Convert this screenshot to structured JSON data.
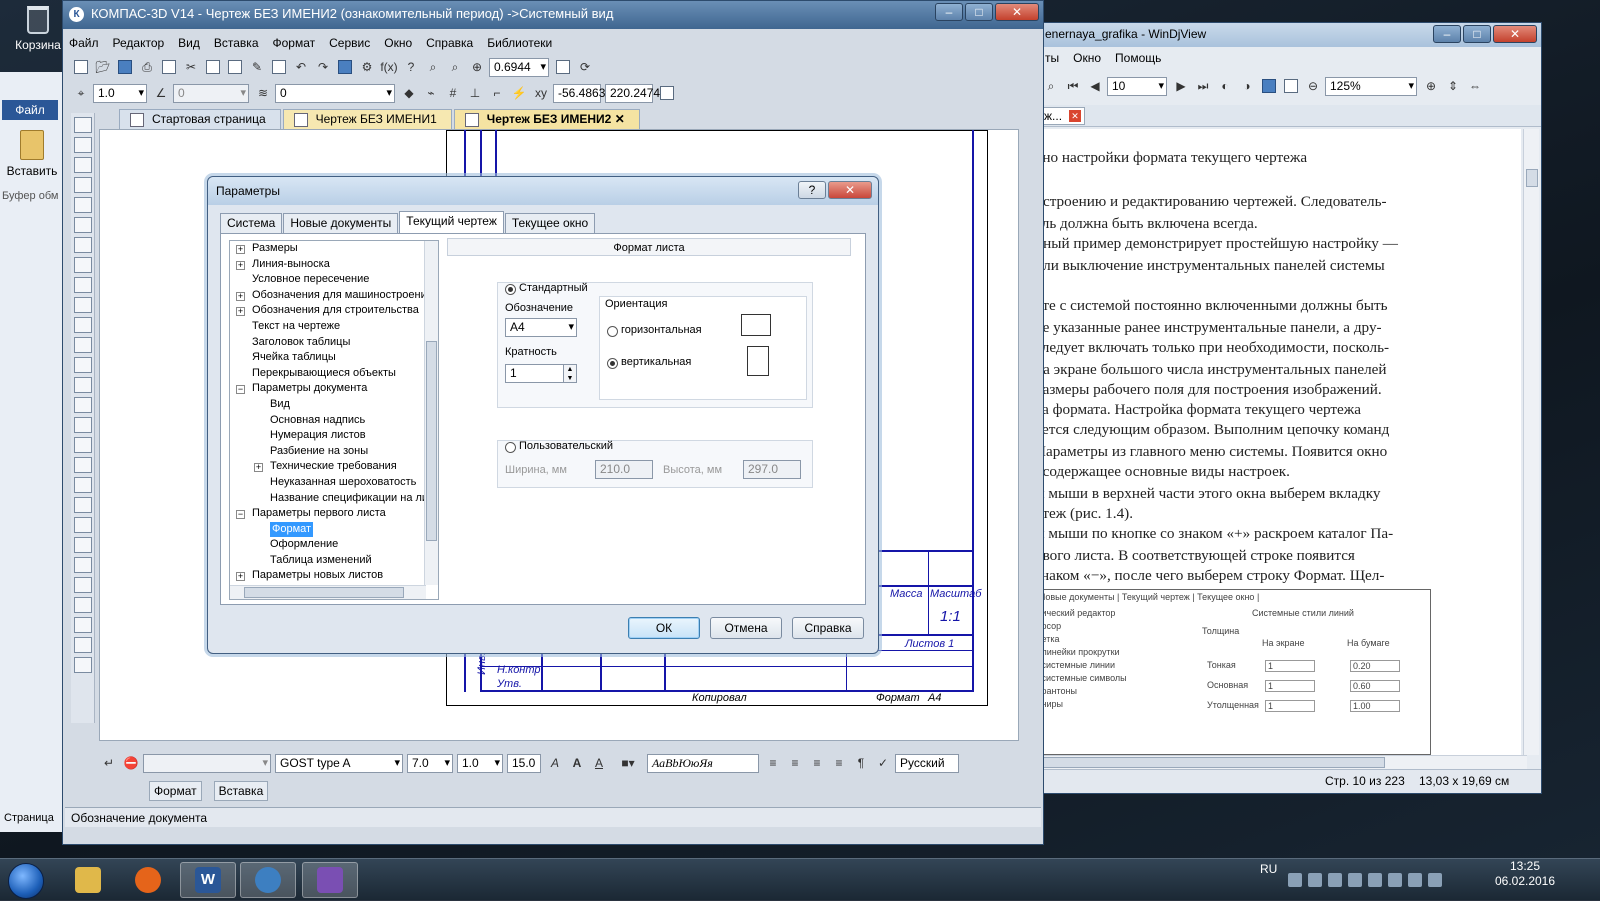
{
  "desktop": {
    "recycle_bin": "Корзина"
  },
  "word": {
    "file_button": "Файл",
    "paste_label": "Вставить",
    "clipboard_label": "Буфер обм",
    "page_label": "Страница"
  },
  "kompas": {
    "title": "КОМПАС-3D V14 - Чертеж БЕЗ ИМЕНИ2 (ознакомительный период) ->Системный вид",
    "menu": [
      "Файл",
      "Редактор",
      "Вид",
      "Вставка",
      "Формат",
      "Сервис",
      "Окно",
      "Справка",
      "Библиотеки"
    ],
    "toolbar1": {
      "zoom": "0.6944"
    },
    "toolbar2": {
      "step": "1.0",
      "angle": "0",
      "layer": "0",
      "coord_x": "-56.4863",
      "coord_y": "220.2474"
    },
    "tabs": [
      {
        "label": "Стартовая страница"
      },
      {
        "label": "Чертеж БЕЗ ИМЕНИ1"
      },
      {
        "label": "Чертеж БЕЗ ИМЕНИ2"
      }
    ],
    "drawing": {
      "massa": "Масса",
      "masshtab": "Масштаб",
      "scale_value": "1:1",
      "listov": "Листов 1",
      "n_kontr": "Н.контр.",
      "utv": "Утв.",
      "kopiroval": "Копировал",
      "format": "Формат",
      "format_value": "A4",
      "inv": "Инв. №"
    },
    "bottom": {
      "font": "GOST type A",
      "height": "7.0",
      "width": "1.0",
      "value15": "15.0",
      "sample": "АаВbЮюЯя",
      "language": "Русский"
    },
    "bottom_tabs": [
      "Формат",
      "Вставка"
    ],
    "status": "Обозначение документа"
  },
  "dialog": {
    "title": "Параметры",
    "help_button": "?",
    "close_button": "✕",
    "tabs": [
      "Система",
      "Новые документы",
      "Текущий чертеж",
      "Текущее окно"
    ],
    "active_tab": "Текущий чертеж",
    "tree": [
      {
        "label": "Размеры",
        "level": 0,
        "expander": "+"
      },
      {
        "label": "Линия-выноска",
        "level": 0,
        "expander": "+"
      },
      {
        "label": "Условное пересечение",
        "level": 0,
        "expander": ""
      },
      {
        "label": "Обозначения для машиностроения",
        "level": 0,
        "expander": "+"
      },
      {
        "label": "Обозначения для строительства",
        "level": 0,
        "expander": "+"
      },
      {
        "label": "Текст на чертеже",
        "level": 0,
        "expander": ""
      },
      {
        "label": "Заголовок таблицы",
        "level": 0,
        "expander": ""
      },
      {
        "label": "Ячейка таблицы",
        "level": 0,
        "expander": ""
      },
      {
        "label": "Перекрывающиеся объекты",
        "level": 0,
        "expander": ""
      },
      {
        "label": "Параметры документа",
        "level": 0,
        "expander": "−"
      },
      {
        "label": "Вид",
        "level": 1,
        "expander": ""
      },
      {
        "label": "Основная надпись",
        "level": 1,
        "expander": ""
      },
      {
        "label": "Нумерация листов",
        "level": 1,
        "expander": ""
      },
      {
        "label": "Разбиение на зоны",
        "level": 1,
        "expander": ""
      },
      {
        "label": "Технические требования",
        "level": 1,
        "expander": "+"
      },
      {
        "label": "Неуказанная шероховатость",
        "level": 1,
        "expander": ""
      },
      {
        "label": "Название спецификации на лист",
        "level": 1,
        "expander": ""
      },
      {
        "label": "Параметры первого листа",
        "level": 0,
        "expander": "−"
      },
      {
        "label": "Формат",
        "level": 1,
        "expander": "",
        "selected": true
      },
      {
        "label": "Оформление",
        "level": 1,
        "expander": ""
      },
      {
        "label": "Таблица изменений",
        "level": 1,
        "expander": ""
      },
      {
        "label": "Параметры новых листов",
        "level": 0,
        "expander": "+"
      }
    ],
    "panel_title": "Формат листа",
    "standard_label": "Стандартный",
    "designation_label": "Обозначение",
    "designation_value": "A4",
    "multiplicity_label": "Кратность",
    "multiplicity_value": "1",
    "orientation_label": "Ориентация",
    "horizontal_label": "горизонтальная",
    "vertical_label": "вертикальная",
    "custom_label": "Пользовательский",
    "width_label": "Ширина, мм",
    "width_value": "210.0",
    "height_label": "Высота, мм",
    "height_value": "297.0",
    "ok": "ОК",
    "cancel": "Отмена",
    "help": "Справка"
  },
  "djview": {
    "title": "...enernaya_grafika - WinDjView",
    "menu": [
      "...ты",
      "Окно",
      "Помощь"
    ],
    "page_number": "10",
    "zoom": "125%",
    "doc_tab": "...ж...",
    "text_lines": [
      "кно настройки формата текущего чертежа",
      "остроению и редактированию чертежей. Следователь-",
      "ель должна быть включена всегда.",
      "нный пример демонстрирует простейшую настройку —",
      "или выключение инструментальных панелей системы",
      "оте с системой постоянно включенными должны быть",
      "ре указанные ранее инструментальные панели, а дру-",
      "следует включать только при необходимости, посколь-",
      "на экране большого числа инструментальных панелей",
      "размеры рабочего поля для построения изображений.",
      "ка формата. Настройка формата текущего чертежа",
      "яется следующим образом. Выполним цепочку команд",
      "Параметры из главного меню системы. Появится окно",
      ", содержащее основные виды настроек.",
      "м мыши в верхней части этого окна выберем вкладку",
      "ртеж (рис. 1.4).",
      "м мыши по кнопке со знаком «+» раскроем каталог Па-",
      "рвого листа. В соответствующей строке появится",
      "знаком «−», после чего выберем строку Формат. Щел-"
    ],
    "figure": {
      "tabs": "| Новые документы | Текущий чертеж | Текущее окно |",
      "left_items": [
        "...ический редактор",
        "...рсор",
        "...етка",
        "...линейки прокрутки",
        "...системные линии",
        "...системные символы",
        "...рантоны",
        "...ниры"
      ],
      "header": "Системные стили линий",
      "col1": "Толщина",
      "col2": "На экране",
      "col3": "На бумаге",
      "rows": [
        {
          "name": "Тонкая",
          "screen": "1",
          "paper": "0.20"
        },
        {
          "name": "Основная",
          "screen": "1",
          "paper": "0.60"
        },
        {
          "name": "Утолщенная",
          "screen": "1",
          "paper": "1.00"
        }
      ]
    },
    "status_page": "Стр. 10 из 223",
    "status_size": "13,03 x 19,69 см"
  },
  "taskbar": {
    "items": [
      "explorer",
      "firefox",
      "word",
      "kompas",
      "djview"
    ],
    "lang": "RU",
    "time": "13:25",
    "date": "06.02.2016"
  }
}
